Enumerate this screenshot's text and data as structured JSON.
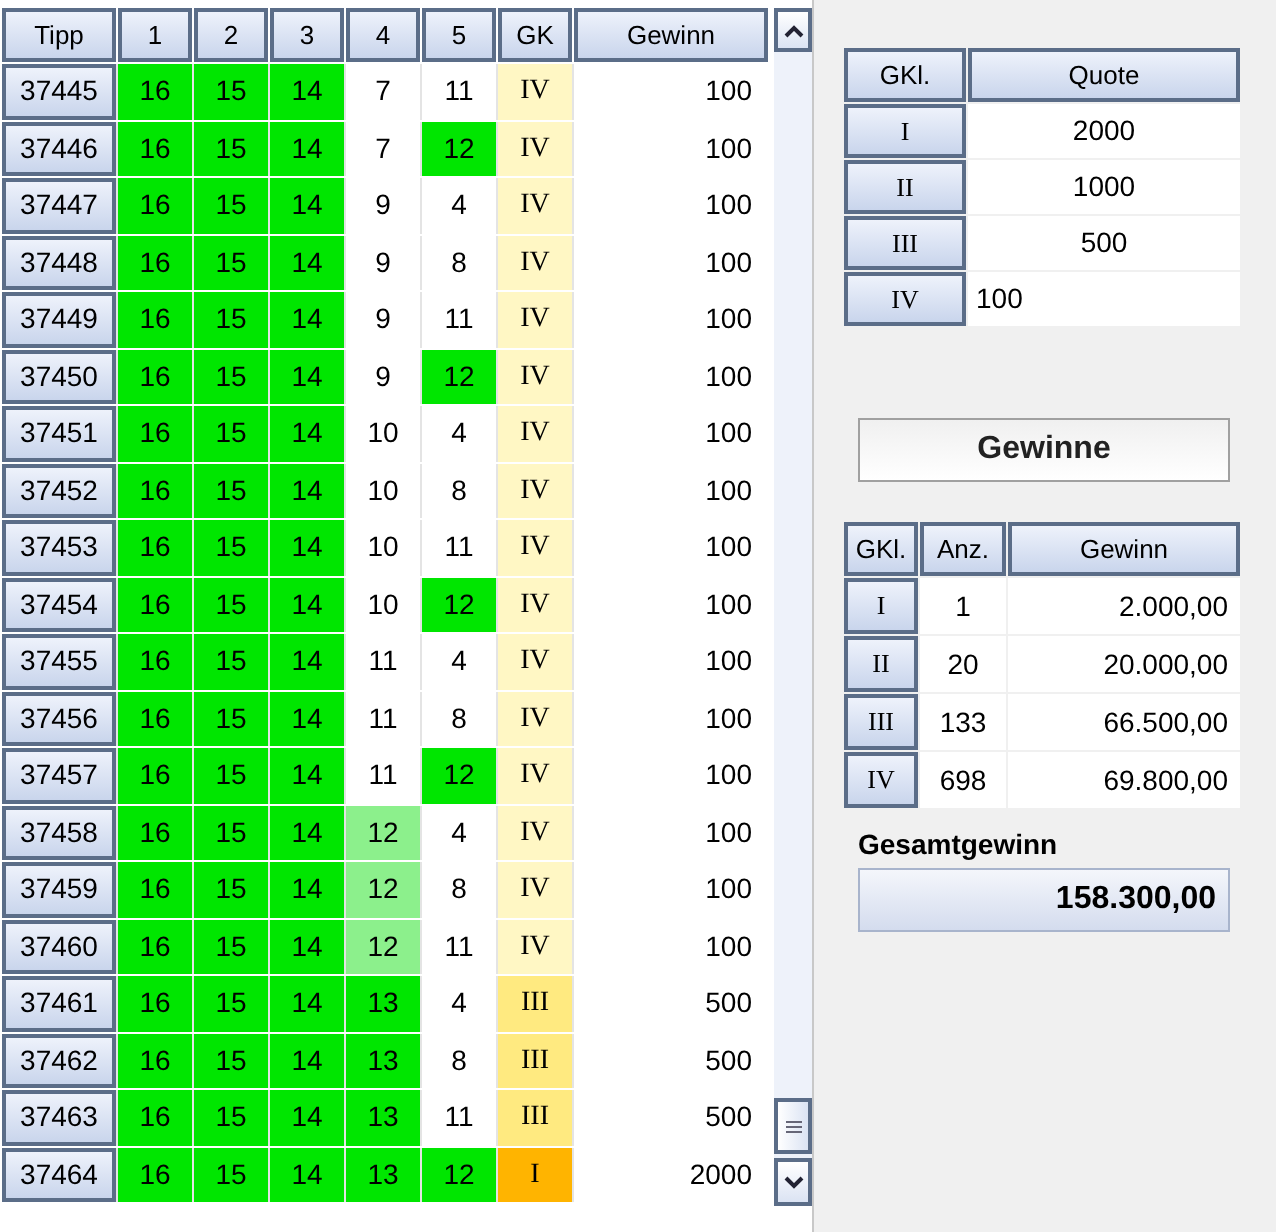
{
  "tickets": {
    "columns": [
      "Tipp",
      "1",
      "2",
      "3",
      "4",
      "5",
      "GK",
      "Gewinn"
    ],
    "rows": [
      {
        "tipp": "37445",
        "numbers": [
          {
            "value": "16",
            "color": "#00e600"
          },
          {
            "value": "15",
            "color": "#00e600"
          },
          {
            "value": "14",
            "color": "#00e600"
          },
          {
            "value": "7",
            "color": "#ffffff"
          },
          {
            "value": "11",
            "color": "#ffffff"
          }
        ],
        "gk": {
          "label": "IV",
          "color": "#fff7c4"
        },
        "gewinn": "100"
      },
      {
        "tipp": "37446",
        "numbers": [
          {
            "value": "16",
            "color": "#00e600"
          },
          {
            "value": "15",
            "color": "#00e600"
          },
          {
            "value": "14",
            "color": "#00e600"
          },
          {
            "value": "7",
            "color": "#ffffff"
          },
          {
            "value": "12",
            "color": "#00e600"
          }
        ],
        "gk": {
          "label": "IV",
          "color": "#fff7c4"
        },
        "gewinn": "100"
      },
      {
        "tipp": "37447",
        "numbers": [
          {
            "value": "16",
            "color": "#00e600"
          },
          {
            "value": "15",
            "color": "#00e600"
          },
          {
            "value": "14",
            "color": "#00e600"
          },
          {
            "value": "9",
            "color": "#ffffff"
          },
          {
            "value": "4",
            "color": "#ffffff"
          }
        ],
        "gk": {
          "label": "IV",
          "color": "#fff7c4"
        },
        "gewinn": "100"
      },
      {
        "tipp": "37448",
        "numbers": [
          {
            "value": "16",
            "color": "#00e600"
          },
          {
            "value": "15",
            "color": "#00e600"
          },
          {
            "value": "14",
            "color": "#00e600"
          },
          {
            "value": "9",
            "color": "#ffffff"
          },
          {
            "value": "8",
            "color": "#ffffff"
          }
        ],
        "gk": {
          "label": "IV",
          "color": "#fff7c4"
        },
        "gewinn": "100"
      },
      {
        "tipp": "37449",
        "numbers": [
          {
            "value": "16",
            "color": "#00e600"
          },
          {
            "value": "15",
            "color": "#00e600"
          },
          {
            "value": "14",
            "color": "#00e600"
          },
          {
            "value": "9",
            "color": "#ffffff"
          },
          {
            "value": "11",
            "color": "#ffffff"
          }
        ],
        "gk": {
          "label": "IV",
          "color": "#fff7c4"
        },
        "gewinn": "100"
      },
      {
        "tipp": "37450",
        "numbers": [
          {
            "value": "16",
            "color": "#00e600"
          },
          {
            "value": "15",
            "color": "#00e600"
          },
          {
            "value": "14",
            "color": "#00e600"
          },
          {
            "value": "9",
            "color": "#ffffff"
          },
          {
            "value": "12",
            "color": "#00e600"
          }
        ],
        "gk": {
          "label": "IV",
          "color": "#fff7c4"
        },
        "gewinn": "100"
      },
      {
        "tipp": "37451",
        "numbers": [
          {
            "value": "16",
            "color": "#00e600"
          },
          {
            "value": "15",
            "color": "#00e600"
          },
          {
            "value": "14",
            "color": "#00e600"
          },
          {
            "value": "10",
            "color": "#ffffff"
          },
          {
            "value": "4",
            "color": "#ffffff"
          }
        ],
        "gk": {
          "label": "IV",
          "color": "#fff7c4"
        },
        "gewinn": "100"
      },
      {
        "tipp": "37452",
        "numbers": [
          {
            "value": "16",
            "color": "#00e600"
          },
          {
            "value": "15",
            "color": "#00e600"
          },
          {
            "value": "14",
            "color": "#00e600"
          },
          {
            "value": "10",
            "color": "#ffffff"
          },
          {
            "value": "8",
            "color": "#ffffff"
          }
        ],
        "gk": {
          "label": "IV",
          "color": "#fff7c4"
        },
        "gewinn": "100"
      },
      {
        "tipp": "37453",
        "numbers": [
          {
            "value": "16",
            "color": "#00e600"
          },
          {
            "value": "15",
            "color": "#00e600"
          },
          {
            "value": "14",
            "color": "#00e600"
          },
          {
            "value": "10",
            "color": "#ffffff"
          },
          {
            "value": "11",
            "color": "#ffffff"
          }
        ],
        "gk": {
          "label": "IV",
          "color": "#fff7c4"
        },
        "gewinn": "100"
      },
      {
        "tipp": "37454",
        "numbers": [
          {
            "value": "16",
            "color": "#00e600"
          },
          {
            "value": "15",
            "color": "#00e600"
          },
          {
            "value": "14",
            "color": "#00e600"
          },
          {
            "value": "10",
            "color": "#ffffff"
          },
          {
            "value": "12",
            "color": "#00e600"
          }
        ],
        "gk": {
          "label": "IV",
          "color": "#fff7c4"
        },
        "gewinn": "100"
      },
      {
        "tipp": "37455",
        "numbers": [
          {
            "value": "16",
            "color": "#00e600"
          },
          {
            "value": "15",
            "color": "#00e600"
          },
          {
            "value": "14",
            "color": "#00e600"
          },
          {
            "value": "11",
            "color": "#ffffff"
          },
          {
            "value": "4",
            "color": "#ffffff"
          }
        ],
        "gk": {
          "label": "IV",
          "color": "#fff7c4"
        },
        "gewinn": "100"
      },
      {
        "tipp": "37456",
        "numbers": [
          {
            "value": "16",
            "color": "#00e600"
          },
          {
            "value": "15",
            "color": "#00e600"
          },
          {
            "value": "14",
            "color": "#00e600"
          },
          {
            "value": "11",
            "color": "#ffffff"
          },
          {
            "value": "8",
            "color": "#ffffff"
          }
        ],
        "gk": {
          "label": "IV",
          "color": "#fff7c4"
        },
        "gewinn": "100"
      },
      {
        "tipp": "37457",
        "numbers": [
          {
            "value": "16",
            "color": "#00e600"
          },
          {
            "value": "15",
            "color": "#00e600"
          },
          {
            "value": "14",
            "color": "#00e600"
          },
          {
            "value": "11",
            "color": "#ffffff"
          },
          {
            "value": "12",
            "color": "#00e600"
          }
        ],
        "gk": {
          "label": "IV",
          "color": "#fff7c4"
        },
        "gewinn": "100"
      },
      {
        "tipp": "37458",
        "numbers": [
          {
            "value": "16",
            "color": "#00e600"
          },
          {
            "value": "15",
            "color": "#00e600"
          },
          {
            "value": "14",
            "color": "#00e600"
          },
          {
            "value": "12",
            "color": "#8cf08c"
          },
          {
            "value": "4",
            "color": "#ffffff"
          }
        ],
        "gk": {
          "label": "IV",
          "color": "#fff7c4"
        },
        "gewinn": "100"
      },
      {
        "tipp": "37459",
        "numbers": [
          {
            "value": "16",
            "color": "#00e600"
          },
          {
            "value": "15",
            "color": "#00e600"
          },
          {
            "value": "14",
            "color": "#00e600"
          },
          {
            "value": "12",
            "color": "#8cf08c"
          },
          {
            "value": "8",
            "color": "#ffffff"
          }
        ],
        "gk": {
          "label": "IV",
          "color": "#fff7c4"
        },
        "gewinn": "100"
      },
      {
        "tipp": "37460",
        "numbers": [
          {
            "value": "16",
            "color": "#00e600"
          },
          {
            "value": "15",
            "color": "#00e600"
          },
          {
            "value": "14",
            "color": "#00e600"
          },
          {
            "value": "12",
            "color": "#8cf08c"
          },
          {
            "value": "11",
            "color": "#ffffff"
          }
        ],
        "gk": {
          "label": "IV",
          "color": "#fff7c4"
        },
        "gewinn": "100"
      },
      {
        "tipp": "37461",
        "numbers": [
          {
            "value": "16",
            "color": "#00e600"
          },
          {
            "value": "15",
            "color": "#00e600"
          },
          {
            "value": "14",
            "color": "#00e600"
          },
          {
            "value": "13",
            "color": "#00e600"
          },
          {
            "value": "4",
            "color": "#ffffff"
          }
        ],
        "gk": {
          "label": "III",
          "color": "#ffea80"
        },
        "gewinn": "500"
      },
      {
        "tipp": "37462",
        "numbers": [
          {
            "value": "16",
            "color": "#00e600"
          },
          {
            "value": "15",
            "color": "#00e600"
          },
          {
            "value": "14",
            "color": "#00e600"
          },
          {
            "value": "13",
            "color": "#00e600"
          },
          {
            "value": "8",
            "color": "#ffffff"
          }
        ],
        "gk": {
          "label": "III",
          "color": "#ffea80"
        },
        "gewinn": "500"
      },
      {
        "tipp": "37463",
        "numbers": [
          {
            "value": "16",
            "color": "#00e600"
          },
          {
            "value": "15",
            "color": "#00e600"
          },
          {
            "value": "14",
            "color": "#00e600"
          },
          {
            "value": "13",
            "color": "#00e600"
          },
          {
            "value": "11",
            "color": "#ffffff"
          }
        ],
        "gk": {
          "label": "III",
          "color": "#ffea80"
        },
        "gewinn": "500"
      },
      {
        "tipp": "37464",
        "numbers": [
          {
            "value": "16",
            "color": "#00e600"
          },
          {
            "value": "15",
            "color": "#00e600"
          },
          {
            "value": "14",
            "color": "#00e600"
          },
          {
            "value": "13",
            "color": "#00e600"
          },
          {
            "value": "12",
            "color": "#00e600"
          }
        ],
        "gk": {
          "label": "I",
          "color": "#ffb400"
        },
        "gewinn": "2000"
      }
    ]
  },
  "quotes": {
    "columns": [
      "GKl.",
      "Quote"
    ],
    "rows": [
      {
        "class": "I",
        "quote": "2000",
        "editing": false
      },
      {
        "class": "II",
        "quote": "1000",
        "editing": false
      },
      {
        "class": "III",
        "quote": "500",
        "editing": false
      },
      {
        "class": "IV",
        "quote": "100",
        "editing": true
      }
    ]
  },
  "winnings_title": "Gewinne",
  "winnings": {
    "columns": [
      "GKl.",
      "Anz.",
      "Gewinn"
    ],
    "rows": [
      {
        "class": "I",
        "count": "1",
        "amount": "2.000,00"
      },
      {
        "class": "II",
        "count": "20",
        "amount": "20.000,00"
      },
      {
        "class": "III",
        "count": "133",
        "amount": "66.500,00"
      },
      {
        "class": "IV",
        "count": "698",
        "amount": "69.800,00"
      }
    ]
  },
  "total": {
    "label": "Gesamtgewinn",
    "value": "158.300,00"
  }
}
